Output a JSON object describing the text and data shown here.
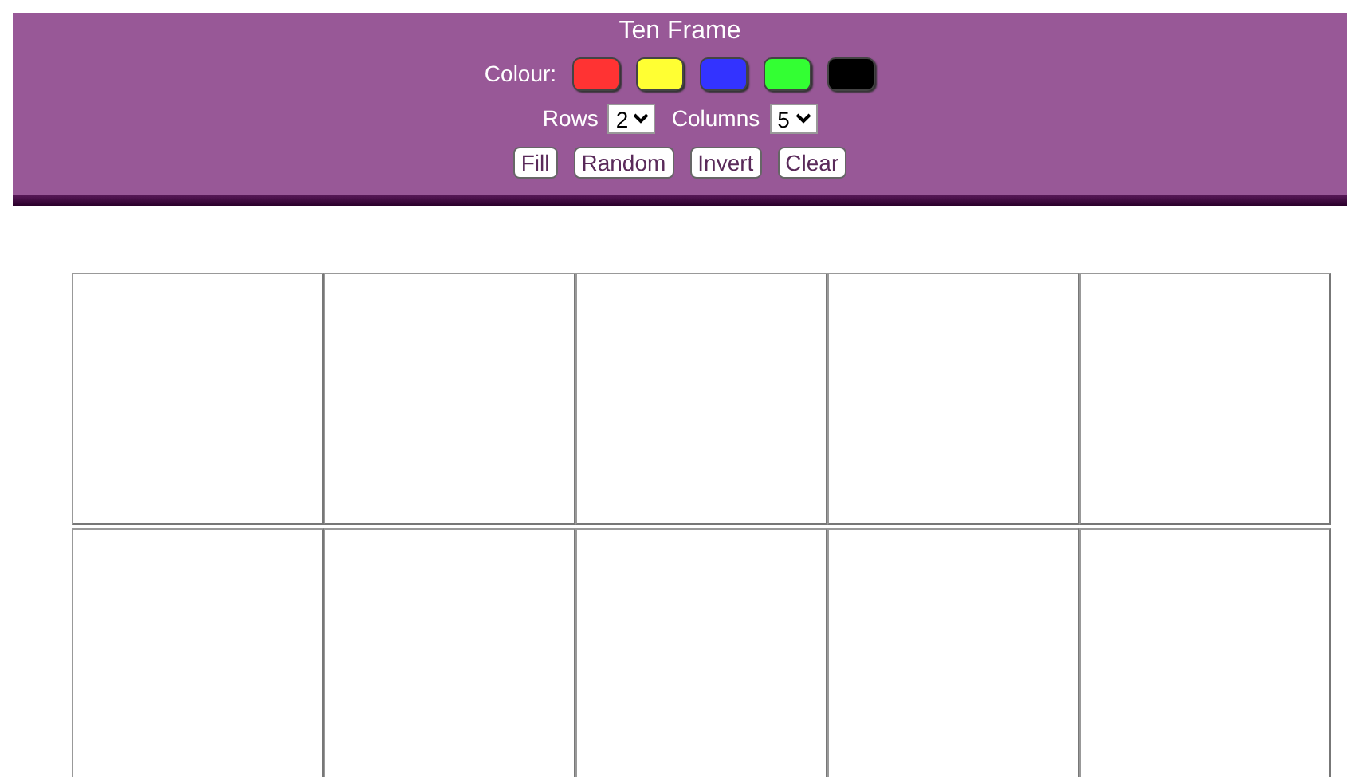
{
  "title": "Ten Frame",
  "colour_label": "Colour:",
  "colours": [
    {
      "color": "#ff3333"
    },
    {
      "color": "#ffff33"
    },
    {
      "color": "#3333ff"
    },
    {
      "color": "#33ff33"
    },
    {
      "color": "#000000"
    }
  ],
  "rows": {
    "label": "Rows",
    "value": "2"
  },
  "columns": {
    "label": "Columns",
    "value": "5"
  },
  "buttons": [
    "Fill",
    "Random",
    "Invert",
    "Clear"
  ]
}
